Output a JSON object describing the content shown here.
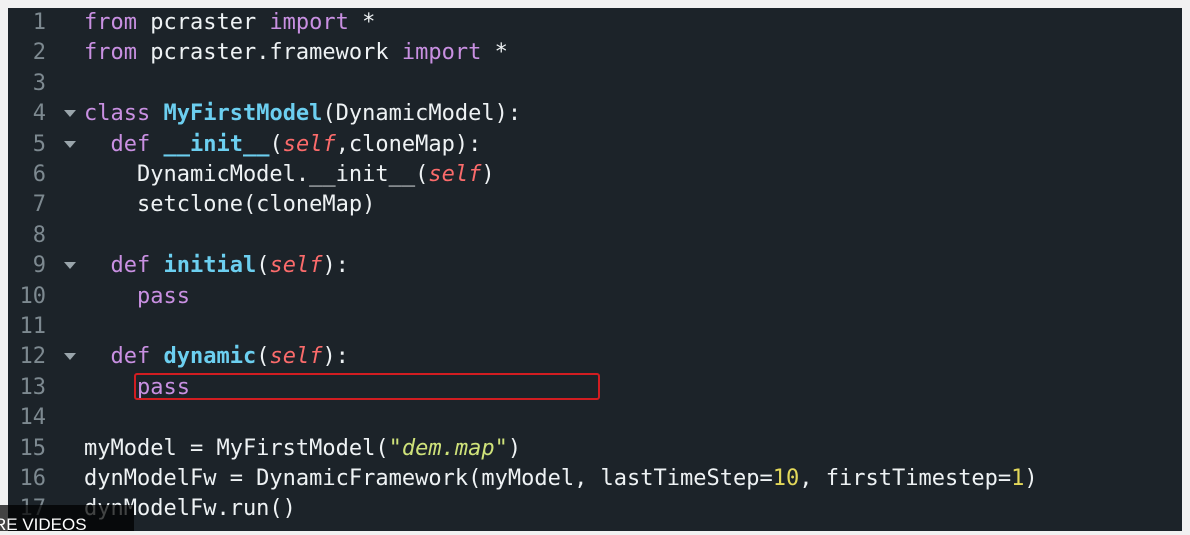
{
  "editor": {
    "lines": [
      {
        "num": "1",
        "fold": false,
        "tokens": [
          [
            "k",
            "from"
          ],
          [
            "o",
            " pcraster "
          ],
          [
            "k",
            "import"
          ],
          [
            "o",
            " *"
          ]
        ]
      },
      {
        "num": "2",
        "fold": false,
        "tokens": [
          [
            "k",
            "from"
          ],
          [
            "o",
            " pcraster.framework "
          ],
          [
            "k",
            "import"
          ],
          [
            "o",
            " *"
          ]
        ]
      },
      {
        "num": "3",
        "fold": false,
        "tokens": []
      },
      {
        "num": "4",
        "fold": true,
        "tokens": [
          [
            "k",
            "class "
          ],
          [
            "f",
            "MyFirstModel"
          ],
          [
            "o",
            "(DynamicModel):"
          ]
        ]
      },
      {
        "num": "5",
        "fold": true,
        "tokens": [
          [
            "o",
            "  "
          ],
          [
            "k",
            "def "
          ],
          [
            "f",
            "__init__"
          ],
          [
            "o",
            "("
          ],
          [
            "p",
            "self"
          ],
          [
            "o",
            ",cloneMap):"
          ]
        ]
      },
      {
        "num": "6",
        "fold": false,
        "tokens": [
          [
            "o",
            "    DynamicModel.__init__("
          ],
          [
            "p",
            "self"
          ],
          [
            "o",
            ")"
          ]
        ]
      },
      {
        "num": "7",
        "fold": false,
        "tokens": [
          [
            "o",
            "    setclone(cloneMap)"
          ]
        ]
      },
      {
        "num": "8",
        "fold": false,
        "tokens": []
      },
      {
        "num": "9",
        "fold": true,
        "tokens": [
          [
            "o",
            "  "
          ],
          [
            "k",
            "def "
          ],
          [
            "f",
            "initial"
          ],
          [
            "o",
            "("
          ],
          [
            "p",
            "self"
          ],
          [
            "o",
            "):"
          ]
        ]
      },
      {
        "num": "10",
        "fold": false,
        "tokens": [
          [
            "o",
            "    "
          ],
          [
            "k",
            "pass"
          ]
        ]
      },
      {
        "num": "11",
        "fold": false,
        "tokens": []
      },
      {
        "num": "12",
        "fold": true,
        "tokens": [
          [
            "o",
            "  "
          ],
          [
            "k",
            "def "
          ],
          [
            "f",
            "dynamic"
          ],
          [
            "o",
            "("
          ],
          [
            "p",
            "self"
          ],
          [
            "o",
            "):"
          ]
        ]
      },
      {
        "num": "13",
        "fold": false,
        "tokens": [
          [
            "o",
            "    "
          ],
          [
            "k",
            "pass"
          ]
        ]
      },
      {
        "num": "14",
        "fold": false,
        "tokens": []
      },
      {
        "num": "15",
        "fold": false,
        "tokens": [
          [
            "o",
            "myModel = MyFirstModel("
          ],
          [
            "s",
            "\"dem.map\""
          ],
          [
            "o",
            ")"
          ]
        ]
      },
      {
        "num": "16",
        "fold": false,
        "tokens": [
          [
            "o",
            "dynModelFw = DynamicFramework(myModel, lastTimeStep="
          ],
          [
            "n",
            "10"
          ],
          [
            "o",
            ", firstTimestep="
          ],
          [
            "n",
            "1"
          ],
          [
            "o",
            ")"
          ]
        ]
      },
      {
        "num": "17",
        "fold": false,
        "tokens": [
          [
            "o",
            "dynModelFw.run()"
          ]
        ]
      }
    ],
    "highlighted_line": "13"
  },
  "overlay": {
    "label": "RE VIDEOS"
  }
}
